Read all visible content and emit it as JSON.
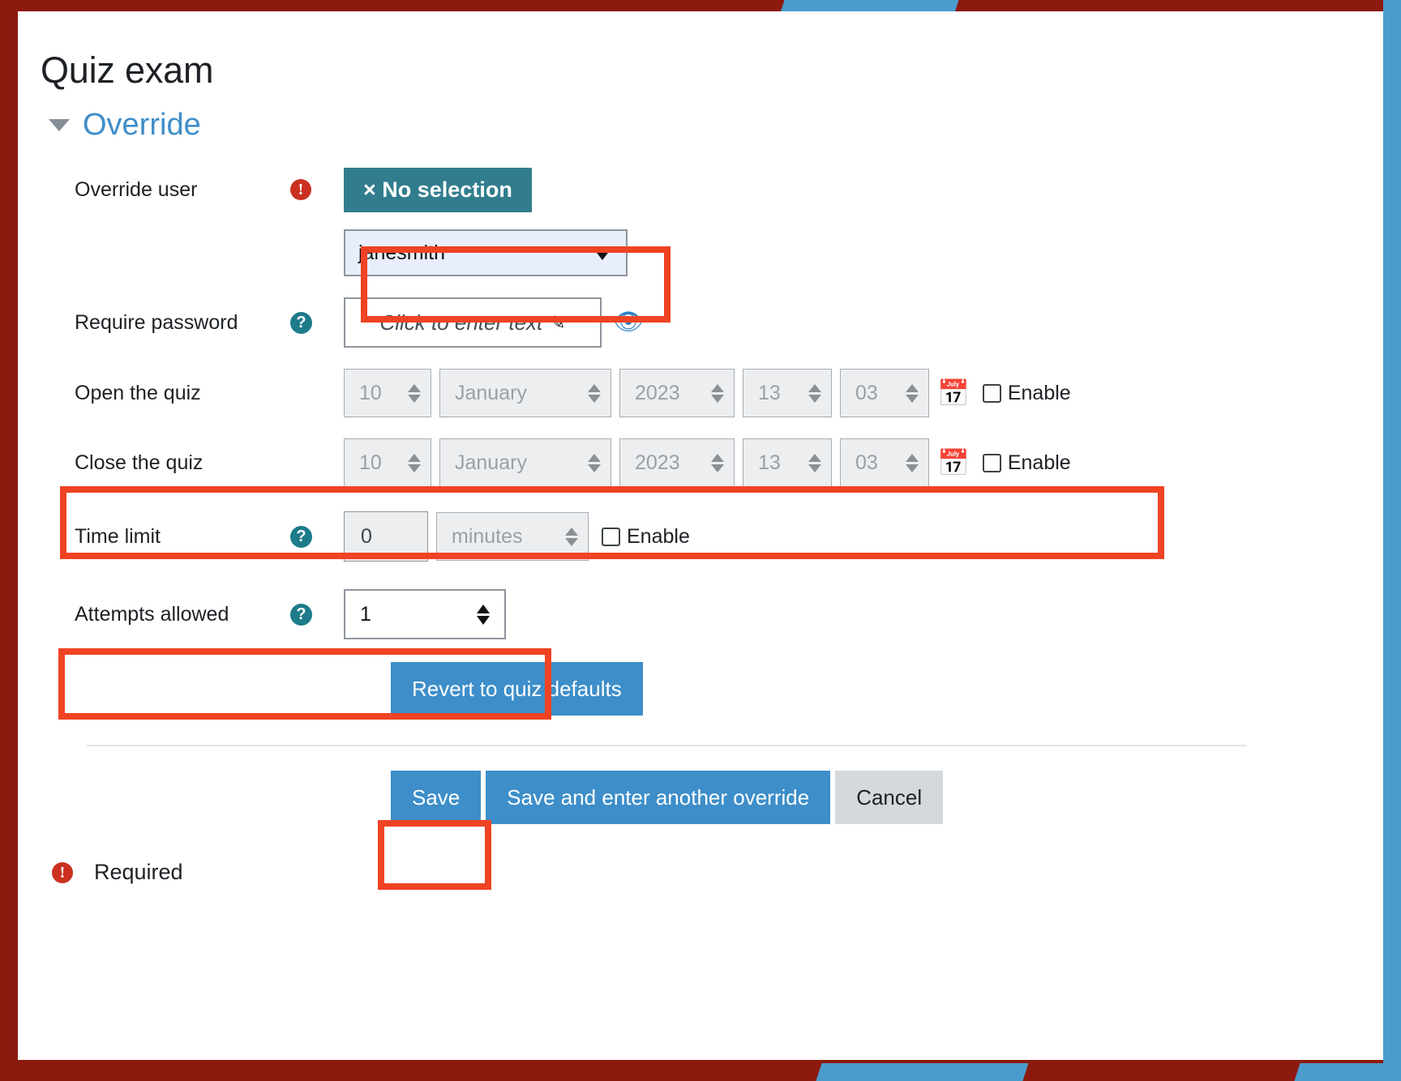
{
  "page": {
    "title": "Quiz exam",
    "section_title": "Override",
    "footer_required_label": "Required"
  },
  "fields": {
    "override_user": {
      "label": "Override user",
      "required_marker": "!",
      "no_selection_badge": "× No selection",
      "selected_user": "janesmith",
      "dropdown_icon": "chevron-down-icon"
    },
    "require_password": {
      "label": "Require password",
      "help_marker": "?",
      "placeholder": "Click to enter text",
      "edit_icon": "pencil-icon",
      "reveal_icon": "eye-icon"
    },
    "open_the_quiz": {
      "label": "Open the quiz",
      "day": "10",
      "month": "January",
      "year": "2023",
      "hour": "13",
      "minute": "03",
      "calendar_icon": "calendar-icon",
      "enable_label": "Enable",
      "enabled": false
    },
    "close_the_quiz": {
      "label": "Close the quiz",
      "day": "10",
      "month": "January",
      "year": "2023",
      "hour": "13",
      "minute": "03",
      "calendar_icon": "calendar-icon",
      "enable_label": "Enable",
      "enabled": false
    },
    "time_limit": {
      "label": "Time limit",
      "help_marker": "?",
      "value": "0",
      "unit": "minutes",
      "enable_label": "Enable",
      "enabled": false
    },
    "attempts_allowed": {
      "label": "Attempts allowed",
      "help_marker": "?",
      "value": "1"
    }
  },
  "buttons": {
    "revert": "Revert to quiz defaults",
    "save": "Save",
    "save_and_another": "Save and enter another override",
    "cancel": "Cancel"
  },
  "colors": {
    "accent_blue": "#3d8ec9",
    "link_blue": "#3f8dc8",
    "teal_badge": "#317d8e",
    "required_red": "#ca3120",
    "annotation_red": "#ef4323",
    "deck_maroon": "#8d1a0f",
    "deck_blue": "#4a9ccd"
  }
}
